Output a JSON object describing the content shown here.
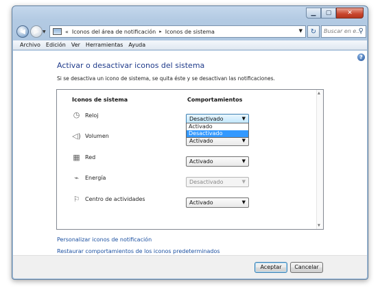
{
  "window": {
    "caption_buttons": {
      "minimize_icon": "minimize-icon",
      "maximize_icon": "maximize-icon",
      "close_icon": "close-icon"
    }
  },
  "address_bar": {
    "overflow_glyph": "«",
    "segments": [
      "Iconos del área de notificación",
      "Iconos de sistema"
    ],
    "separator": "▸"
  },
  "search": {
    "placeholder": "Buscar en e..."
  },
  "menu": {
    "items": [
      "Archivo",
      "Edición",
      "Ver",
      "Herramientas",
      "Ayuda"
    ]
  },
  "page": {
    "title": "Activar o desactivar iconos del sistema",
    "description": "Si se desactiva un icono de sistema, se quita éste y se desactivan las notificaciones."
  },
  "table": {
    "col_icons": "Iconos de sistema",
    "col_behaviors": "Comportamientos",
    "rows": [
      {
        "label": "Reloj",
        "icon": "clock-icon",
        "value": "Desactivado",
        "state": "open"
      },
      {
        "label": "Volumen",
        "icon": "speaker-icon",
        "value": "Activado",
        "state": "normal"
      },
      {
        "label": "Red",
        "icon": "network-icon",
        "value": "Activado",
        "state": "normal"
      },
      {
        "label": "Energía",
        "icon": "power-icon",
        "value": "Desactivado",
        "state": "disabled"
      },
      {
        "label": "Centro de actividades",
        "icon": "flag-icon",
        "value": "Activado",
        "state": "normal"
      }
    ],
    "dropdown_options": [
      "Activado",
      "Desactivado"
    ],
    "dropdown_selected": "Desactivado"
  },
  "links": {
    "customize": "Personalizar iconos de notificación",
    "restore": "Restaurar comportamientos de los iconos predeterminados"
  },
  "buttons": {
    "accept": "Aceptar",
    "cancel": "Cancelar"
  }
}
